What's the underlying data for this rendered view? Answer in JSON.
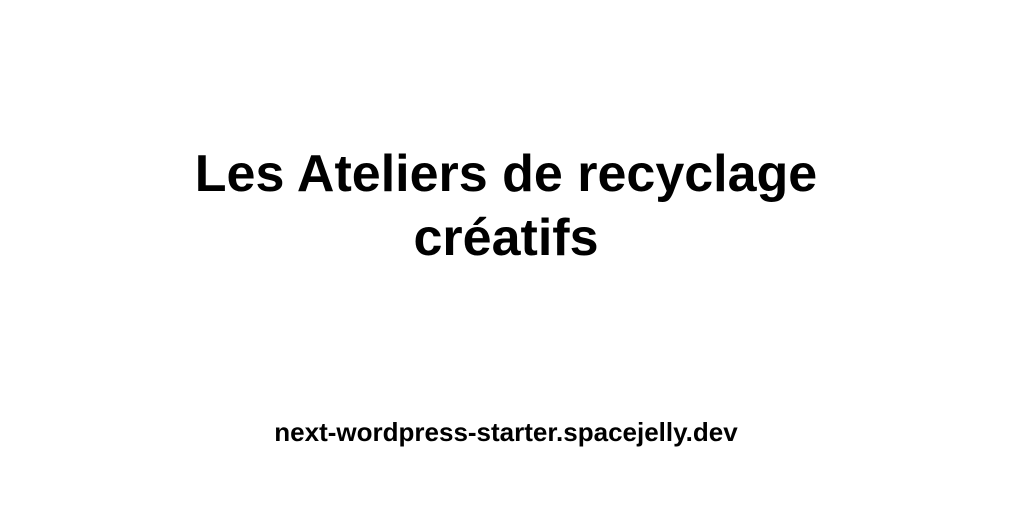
{
  "card": {
    "title": "Les Ateliers de recyclage créatifs",
    "site": "next-wordpress-starter.spacejelly.dev"
  }
}
